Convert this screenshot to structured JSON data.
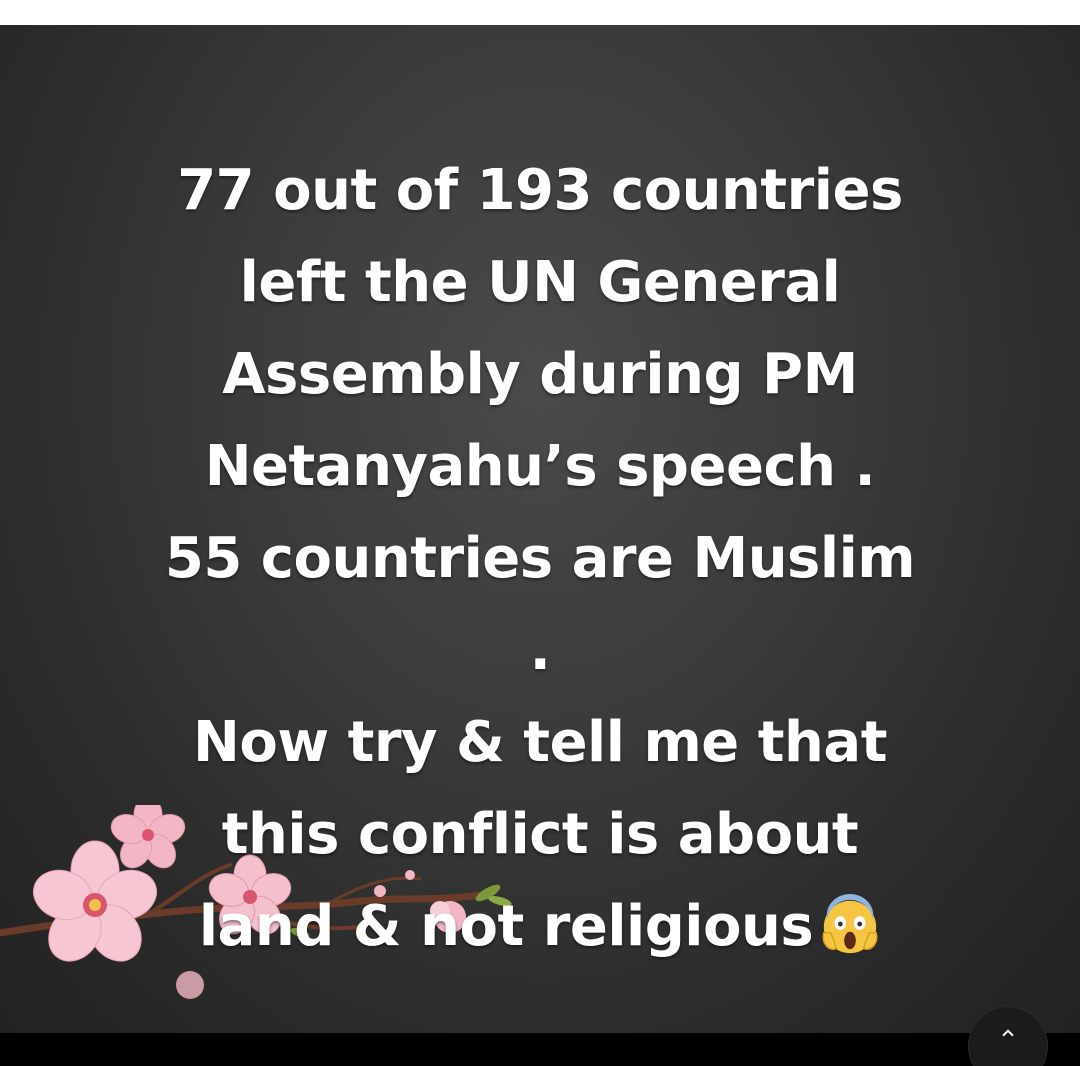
{
  "post": {
    "lines": [
      "77 out of 193 countries",
      "left the UN General",
      "Assembly during PM",
      "Netanyahu’s speech .",
      "55 countries are Muslim",
      ".",
      "Now try & tell me that",
      "this conflict is about",
      "land & not religious"
    ],
    "emoji_icon": "face-screaming-in-fear-icon"
  },
  "colors": {
    "text": "#ffffff",
    "background": "#333333",
    "blossom": "#f2bcc8",
    "branch": "#6b3b2a"
  },
  "decoration": "cherry-blossom-branch"
}
